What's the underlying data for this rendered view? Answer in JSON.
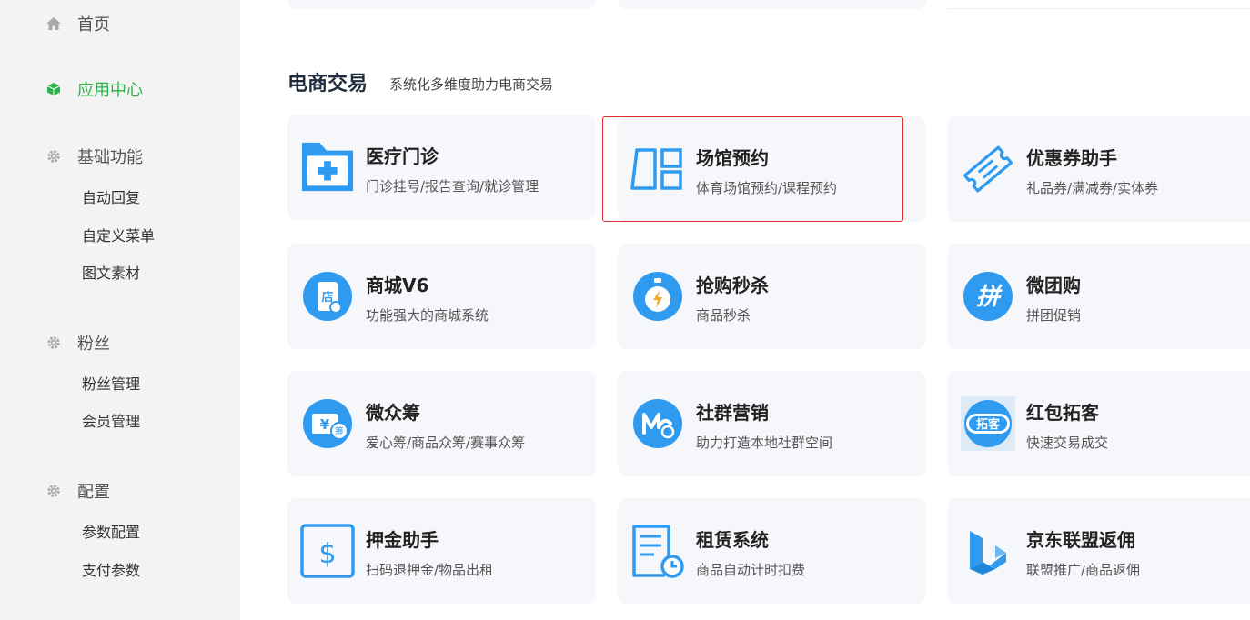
{
  "sidebar": {
    "home": "首页",
    "app_center": "应用中心",
    "basic": {
      "title": "基础功能",
      "items": [
        "自动回复",
        "自定义菜单",
        "图文素材"
      ]
    },
    "fans": {
      "title": "粉丝",
      "items": [
        "粉丝管理",
        "会员管理"
      ]
    },
    "config": {
      "title": "配置",
      "items": [
        "参数配置",
        "支付参数"
      ]
    }
  },
  "section": {
    "title": "电商交易",
    "subtitle": "系统化多维度助力电商交易"
  },
  "cards": [
    {
      "title": "医疗门诊",
      "desc": "门诊挂号/报告查询/就诊管理",
      "icon": "medical-folder-icon"
    },
    {
      "title": "场馆预约",
      "desc": "体育场馆预约/课程预约",
      "icon": "venue-icon"
    },
    {
      "title": "优惠券助手",
      "desc": "礼品券/满减券/实体券",
      "icon": "coupon-icon"
    },
    {
      "title": "商城V6",
      "desc": "功能强大的商城系统",
      "icon": "shop-icon"
    },
    {
      "title": "抢购秒杀",
      "desc": "商品秒杀",
      "icon": "stopwatch-icon"
    },
    {
      "title": "微团购",
      "desc": "拼团促销",
      "icon": "group-buy-icon"
    },
    {
      "title": "微众筹",
      "desc": "爱心筹/商品众筹/赛事众筹",
      "icon": "crowdfunding-icon"
    },
    {
      "title": "社群营销",
      "desc": "助力打造本地社群空间",
      "icon": "community-icon"
    },
    {
      "title": "红包拓客",
      "desc": "快速交易成交",
      "icon": "red-packet-icon"
    },
    {
      "title": "押金助手",
      "desc": "扫码退押金/物品出租",
      "icon": "deposit-icon"
    },
    {
      "title": "租赁系统",
      "desc": "商品自动计时扣费",
      "icon": "rental-icon"
    },
    {
      "title": "京东联盟返佣",
      "desc": "联盟推广/商品返佣",
      "icon": "jd-union-icon"
    }
  ],
  "icon_texts": {
    "shop": "店",
    "group_buy": "拼",
    "crowdfunding": "筹",
    "red_packet": "拓客"
  },
  "colors": {
    "accent_green": "#2db34a",
    "icon_blue": "#2f9bf0",
    "highlight_red": "#e02b2b"
  }
}
